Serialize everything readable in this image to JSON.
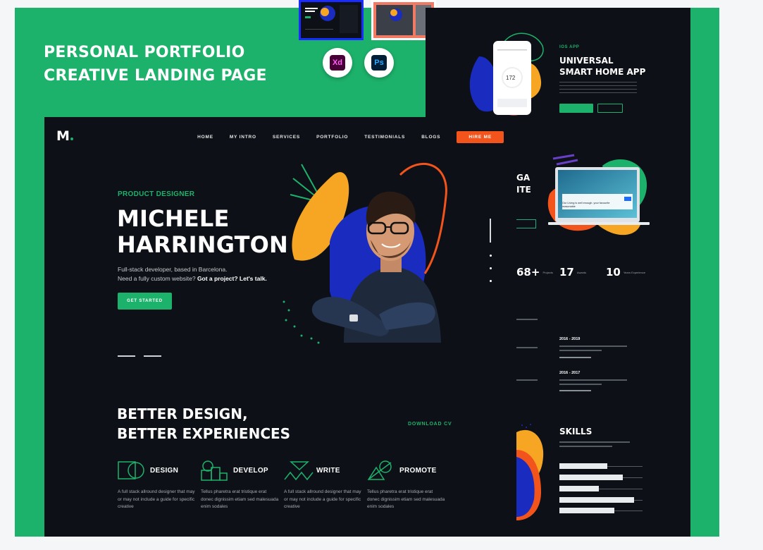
{
  "banner": {
    "line1": "PERSONAL PORTFOLIO",
    "line2": "CREATIVE LANDING PAGE",
    "badges": [
      {
        "label": "Xd",
        "color": "#ff2bc2",
        "bg": "#470137"
      },
      {
        "label": "Ps",
        "color": "#31a8ff",
        "bg": "#001e36"
      }
    ],
    "brand_color": "#1db26b"
  },
  "nav": {
    "logo": "M",
    "items": [
      "HOME",
      "MY INTRO",
      "SERVICES",
      "PORTFOLIO",
      "TESTIMONIALS",
      "BLOGS"
    ],
    "hire": "HIRE ME"
  },
  "hero": {
    "eyebrow": "PRODUCT DESIGNER",
    "name_line1": "MICHELE",
    "name_line2": "HARRINGTON",
    "bio_line1": "Full-stack developer, based in Barcelona.",
    "bio_line2": "Need a fully custom website?",
    "bio_bold": "Got a project? Let's talk.",
    "cta": "GET STARTED"
  },
  "services": {
    "title_line1": "BETTER DESIGN,",
    "title_line2": "BETTER EXPERIENCES",
    "download": "DOWNLOAD CV",
    "items": [
      {
        "title": "DESIGN",
        "icon": "design-icon",
        "desc": "A full stack allround designer that may or may not include a guide for specific creative"
      },
      {
        "title": "DEVELOP",
        "icon": "develop-icon",
        "desc": "Tellus pharetra erat tristique erat donec dignissim etiam sed malesuada enim sodales"
      },
      {
        "title": "WRITE",
        "icon": "write-icon",
        "desc": "A full stack allround designer that may or may not include a guide for specific creative"
      },
      {
        "title": "PROMOTE",
        "icon": "promote-icon",
        "desc": "Tellus pharetra erat tristique erat donec dignissim etiam sed malesuada enim sodales"
      }
    ]
  },
  "right_panel": {
    "tag": "IOS APP",
    "title_line1": "UNIVERSAL",
    "title_line2": "SMART HOME APP",
    "phone_value": "172",
    "laptop_text": "Our Living is well enough. your favourite reasonable",
    "partial_a": "GA",
    "partial_b": "ITE",
    "stats": [
      {
        "value": "68+",
        "label": "Projects"
      },
      {
        "value": "17",
        "label": "Awards"
      },
      {
        "value": "10",
        "label": "Years Experience"
      }
    ],
    "years": [
      "2016 - 2019",
      "2016 - 2017"
    ],
    "skills_title": "SKILLS"
  },
  "colors": {
    "accent": "#1db26b",
    "orange": "#f2541b",
    "blue": "#1a2bbf",
    "yellow": "#f6a623",
    "dark": "#0d1117"
  }
}
